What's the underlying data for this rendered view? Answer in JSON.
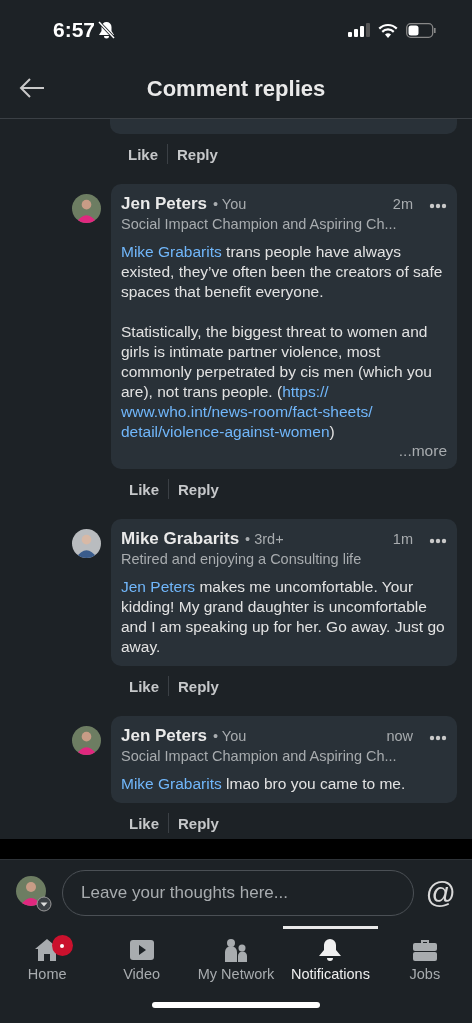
{
  "status_bar": {
    "time": "6:57"
  },
  "header": {
    "title": "Comment replies"
  },
  "comments": [
    {
      "kind": "partial",
      "actions": [
        "Like",
        "Reply"
      ]
    },
    {
      "kind": "full",
      "author": "Jen Peters",
      "relation": "• You",
      "time": "2m",
      "headline": "Social Impact Champion and Aspiring Ch...",
      "paragraphs": [
        [
          {
            "kind": "mention",
            "text": "Mike Grabarits"
          },
          {
            "kind": "text",
            "text": " trans people have always existed, they’ve often been the creators of safe spaces that benefit everyone."
          }
        ],
        [
          {
            "kind": "text",
            "text": "Statistically, the biggest threat to women and girls is intimate partner violence, most commonly perpetrated by cis men (which you are), not trans people. ("
          },
          {
            "kind": "link",
            "text": "https://"
          },
          {
            "kind": "link",
            "text": "www.who.int/news-room/fact-sheets/"
          },
          {
            "kind": "link",
            "text": "detail/violence-against-women"
          },
          {
            "kind": "text",
            "text": ")"
          }
        ]
      ],
      "more": "...more",
      "actions": [
        "Like",
        "Reply"
      ]
    },
    {
      "kind": "full",
      "author": "Mike Grabarits",
      "relation": "• 3rd+",
      "time": "1m",
      "headline": "Retired and enjoying a Consulting life",
      "paragraphs": [
        [
          {
            "kind": "mention",
            "text": "Jen Peters"
          },
          {
            "kind": "text",
            "text": " makes me uncomfortable. Your kidding! My grand daughter is uncomfortable and I am speaking up for her. Go away. Just go away."
          }
        ]
      ],
      "actions": [
        "Like",
        "Reply"
      ]
    },
    {
      "kind": "full",
      "author": "Jen Peters",
      "relation": "• You",
      "time": "now",
      "headline": "Social Impact Champion and Aspiring Ch...",
      "paragraphs": [
        [
          {
            "kind": "mention",
            "text": "Mike Grabarits"
          },
          {
            "kind": "text",
            "text": " lmao bro you came to me."
          }
        ]
      ],
      "actions": [
        "Like",
        "Reply"
      ]
    }
  ],
  "composer": {
    "placeholder": "Leave your thoughts here...",
    "mention_symbol": "@"
  },
  "nav": [
    {
      "kind": "home",
      "label": "Home",
      "selected": false,
      "badge": true
    },
    {
      "kind": "video",
      "label": "Video",
      "selected": false,
      "badge": false
    },
    {
      "kind": "network",
      "label": "My Network",
      "selected": false,
      "badge": false
    },
    {
      "kind": "notifications",
      "label": "Notifications",
      "selected": true,
      "badge": false
    },
    {
      "kind": "jobs",
      "label": "Jobs",
      "selected": false,
      "badge": false
    }
  ]
}
